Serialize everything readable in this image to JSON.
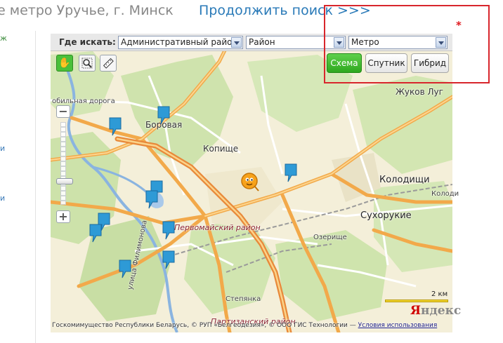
{
  "header": {
    "title": "е метро Уручье, г. Минск",
    "continue_link": "Продолжить поиск >>>"
  },
  "left_marks": [
    "ж",
    "и",
    "и"
  ],
  "search": {
    "label": "Где искать:",
    "district_select": "Административный район",
    "area_select": "Район",
    "metro_select": "Метро"
  },
  "map_types": {
    "scheme": "Схема",
    "satellite": "Спутник",
    "hybrid": "Гибрид"
  },
  "tools": [
    "hand-icon",
    "magnifier-icon",
    "ruler-icon"
  ],
  "zoom": {
    "plus": "+",
    "minus": "−"
  },
  "labels": {
    "borovaya": "Боровая",
    "kopische": "Копище",
    "kolodischi": "Колодищи",
    "kolodischi_road": "Колоди",
    "sukhorukie": "Сухорукие",
    "zhukov_lug": "Жуков Луг",
    "ring_road": "обильная дорога",
    "district": "Первомайский район",
    "ozerische": "Озерище",
    "street": "улица Филимонова",
    "stepyanka": "Степянка",
    "partizansky": "Партизанский район"
  },
  "scale": "2 км",
  "logo": {
    "first": "Я",
    "rest": "ндекс"
  },
  "copyright": {
    "text": "Госкомимущество Республики Беларусь, © РУП «Белгеодезия», © ООО ГИС Технологии — ",
    "terms": "Условия использования"
  },
  "annotation_mark": "*",
  "colors": {
    "accent_green": "#2ea81f",
    "link_blue": "#2a7ab8",
    "highlight_red": "#d8262c",
    "pin_blue": "#2e9ad6"
  }
}
